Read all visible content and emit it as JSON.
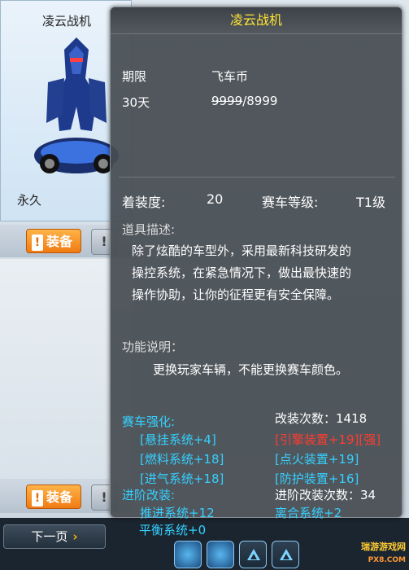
{
  "background": {
    "item_title": "凌云战机",
    "duration": "永久",
    "equip_label": "装备",
    "more_label": "!",
    "next_page": "下一页",
    "watermark_main": "瑞游游戏网",
    "watermark_sub": "PX8.COM"
  },
  "tooltip": {
    "title": "凌云战机",
    "period_label": "期限",
    "period_value": "30天",
    "currency_label": "飞车币",
    "price_original": "9999",
    "price_current": "/8999",
    "equip_level_label": "着装度:",
    "equip_level_value": "20",
    "car_grade_label": "赛车等级:",
    "car_grade_value": "T1级",
    "desc_head": "道具描述:",
    "desc_lines": [
      "除了炫酷的车型外，采用最新科技研发的",
      "操控系统，在紧急情况下，做出最快速的",
      "操作协助，让你的征程更有安全保障。"
    ],
    "func_head": "功能说明：",
    "func_text": "更换玩家车辆，不能更换赛车颜色。",
    "enhance_head": "赛车强化:",
    "mod_count_label": "改装次数：",
    "mod_count_value": "1418",
    "enhance_items": [
      "[悬挂系统+4]",
      "[燃料系统+18]",
      "[进气系统+18]",
      "[引擎装置+19][强]",
      "[点火装置+19]",
      "[防护装置+16]"
    ],
    "advanced_head": "进阶改装:",
    "advanced_count_label": "进阶改装次数：",
    "advanced_count_value": "34",
    "advanced_items": [
      "推进系统+12",
      "离合系统+2",
      "平衡系统+0"
    ]
  },
  "colors": {
    "title_yellow": "#ffe433",
    "stat_cyan": "#35d0ff",
    "stat_red": "#ff3b30",
    "button_orange": "#f07b13"
  }
}
